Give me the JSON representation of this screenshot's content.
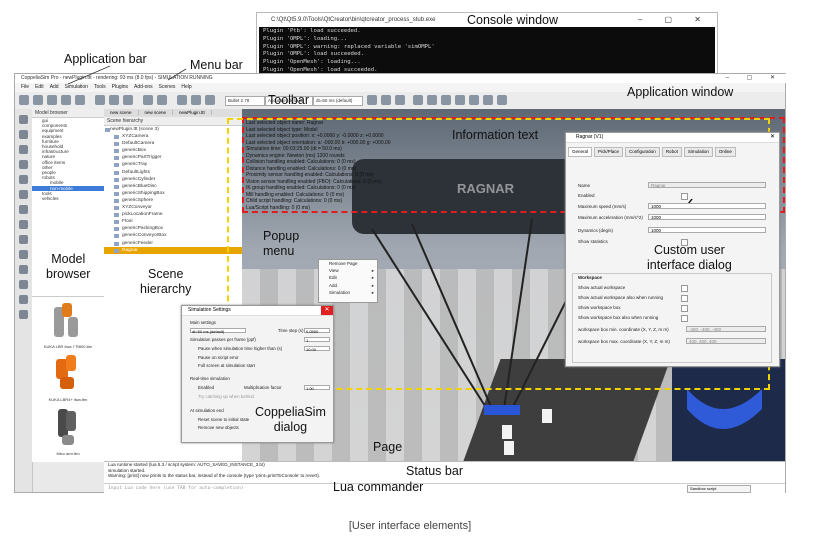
{
  "console": {
    "title": "C:\\Qt\\Qt5.9.0\\Tools\\QtCreator\\bin\\qtcreator_process_stub.exe",
    "lines": [
      "Plugin 'Ptb': load succeeded.",
      "Plugin 'OMPL': loading...",
      "Plugin 'OMPL': warning: replaced variable 'simOMPL'",
      "Plugin 'OMPL': load succeeded.",
      "Plugin 'OpenMesh': loading...",
      "Plugin 'OpenMesh': load succeeded."
    ]
  },
  "app": {
    "title": "CoppeliaSim Pro - newPlugin.ttt - rendering: 93 ms (8.0 fps) - SIMULATION RUNNING",
    "menus": [
      "File",
      "Edit",
      "Add",
      "Simulation",
      "Tools",
      "Plugins",
      "Add-ons",
      "Scenes",
      "Help"
    ],
    "toolbar_combo_1": "Bullet 2.78",
    "toolbar_combo_2": "Accurate (default)",
    "toolbar_combo_3": "dt=50 ms (default)"
  },
  "model_browser": {
    "header": "Model browser",
    "items": [
      "gui",
      "components",
      "equipment",
      "examples",
      "furniture",
      "household",
      "infrastructure",
      "nature",
      "office items",
      "other",
      "people",
      "robots",
      "mobile",
      "non-mobile",
      "tools",
      "vehicles"
    ],
    "selected": "non-mobile",
    "robots": [
      "KUKA LBR iiwa 7 R800.ttm",
      "KUKA LBR4+ iiwa.ttm",
      "Mico arm.ttm"
    ]
  },
  "scene_hierarchy": {
    "tabs": [
      "new scene",
      "new scene",
      "newPlugin.ttt"
    ],
    "header": "Scene hierarchy",
    "items": [
      "newPlugin.ttt (scene 3)",
      "XYZCamera",
      "DefaultCamera",
      "genericBox",
      "genericPartTrigger",
      "genericTray",
      "DefaultLights",
      "genericCylinder",
      "genericBlueDisc",
      "genericShippingBox",
      "genericSphere",
      "XYZConveyor",
      "pickLocationFrame",
      "Floor",
      "genericPackingBox",
      "genericConveyorBox",
      "genericFeeder",
      "Ragnar"
    ],
    "selected": "Ragnar"
  },
  "info_text": [
    "Last selected object name: Ragnar",
    "Last selected object type: Model",
    "Last selected object position: x: +0.0000 y: -0.0000 z: +0.0000",
    "Last selected object orientation: a: -000.00 b: +000.00 g: +000.00",
    "Simulation time: 00:03:25.00 (dt = 50.0 ms)",
    "Dynamics engine: Newton (ms) 1200 rounds",
    "Collision handling enabled: Calculations: 0 (0 ms)",
    "Distance handling enabled: Calculations: 0 (0 ms)",
    "Proximity sensor handling enabled: Calculations: 0 (0 ms)",
    "Vision sensor handling enabled (FBO): Calculations: 0 (0 ms)",
    "IK group handling enabled: Calculations: 0 (0 ms)",
    "Mill handling enabled: Calculations: 0 (0 ms)",
    "Child script handling: Calculations: 0 (0 ms)",
    "Lua/Script handling: 0 (0 ms)"
  ],
  "popup_menu": {
    "items": [
      "Remove Page",
      "View",
      "Edit",
      "Add",
      "Simulation"
    ]
  },
  "custom_dialog": {
    "title": "Ragnar (V1)",
    "tabs": [
      "General",
      "Pick/Place",
      "Configuration",
      "Robot",
      "Simulation",
      "Online"
    ],
    "name_label": "Name",
    "name_value": "Ragnar",
    "enabled_label": "Enabled",
    "max_speed_label": "Maximum speed (mm/s)",
    "max_speed_value": "1000",
    "max_accel_label": "Maximum acceleration (mm/s^2)",
    "max_accel_value": "1000",
    "dynamics_label": "Dynamics (deg/s)",
    "dynamics_value": "1000",
    "show_stats_label": "Show statistics",
    "workspace_header": "Workspace",
    "ws_items": [
      "Show actual workspace",
      "Show actual workspace also when running",
      "Show workspace box",
      "Show workspace box also when running"
    ],
    "ws_box_min_label": "workspace box min. coordinate (X, Y, Z, m m)",
    "ws_box_min_value": "-400, -400, -400",
    "ws_box_max_label": "workspace box max. coordinate (X, Y, Z, m m)",
    "ws_box_max_value": "400, 400, 400"
  },
  "sim_dialog": {
    "title": "Simulation Settings",
    "main_settings": "Main settings",
    "engine_label": "dt=50 ms (default)",
    "time_step_label": "Time step (s)",
    "time_step_value": "0.0500",
    "passes_label": "Simulation passes per frame (ppf)",
    "passes_value": "1",
    "pause_sim_time": "Pause when simulation time higher than (s)",
    "pause_value": "10.00",
    "pause_on_error": "Pause on script error",
    "full_screen": "Full screen at simulation start",
    "realtime_header": "Real-time simulation",
    "enabled": "Enabled",
    "multiplication_label": "Multiplication factor",
    "multiplication_value": "1.00",
    "catch_up": "Try catching up when behind",
    "at_end_header": "At simulation end",
    "reset_scene": "Reset scene to initial state",
    "remove_new": "Remove new objects"
  },
  "status_bar": {
    "lines": [
      "Lua runtime started (lua 5.3 / script system: AUTO_SAVED_INSTANCE_3.bt)",
      "simulation started.",
      "Warning: [print] now prints to the status bar, instead of the console (type 'print=printToConsole' to revert)."
    ]
  },
  "lua_commander": {
    "placeholder": "Input Lua code here (use TAB for auto-completion)",
    "script": "Sandbox script"
  },
  "callouts": {
    "console_window": "Console window",
    "application_bar": "Application bar",
    "menu_bar": "Menu bar",
    "toolbar": "Toolbar",
    "application_window": "Application window",
    "information_text": "Information text",
    "popup_menu": "Popup\nmenu",
    "custom_dialog": "Custom user\ninterface dialog",
    "model_browser": "Model\nbrowser",
    "scene_hierarchy": "Scene\nhierarchy",
    "coppeliasim_dialog": "CoppeliaSim\ndialog",
    "page": "Page",
    "status_bar": "Status bar",
    "lua_commander": "Lua commander"
  },
  "caption": "[User interface elements]",
  "colors": {
    "info_border": "#e21c1c",
    "page_border": "#f1d300",
    "selection_orange": "#e8a400"
  }
}
